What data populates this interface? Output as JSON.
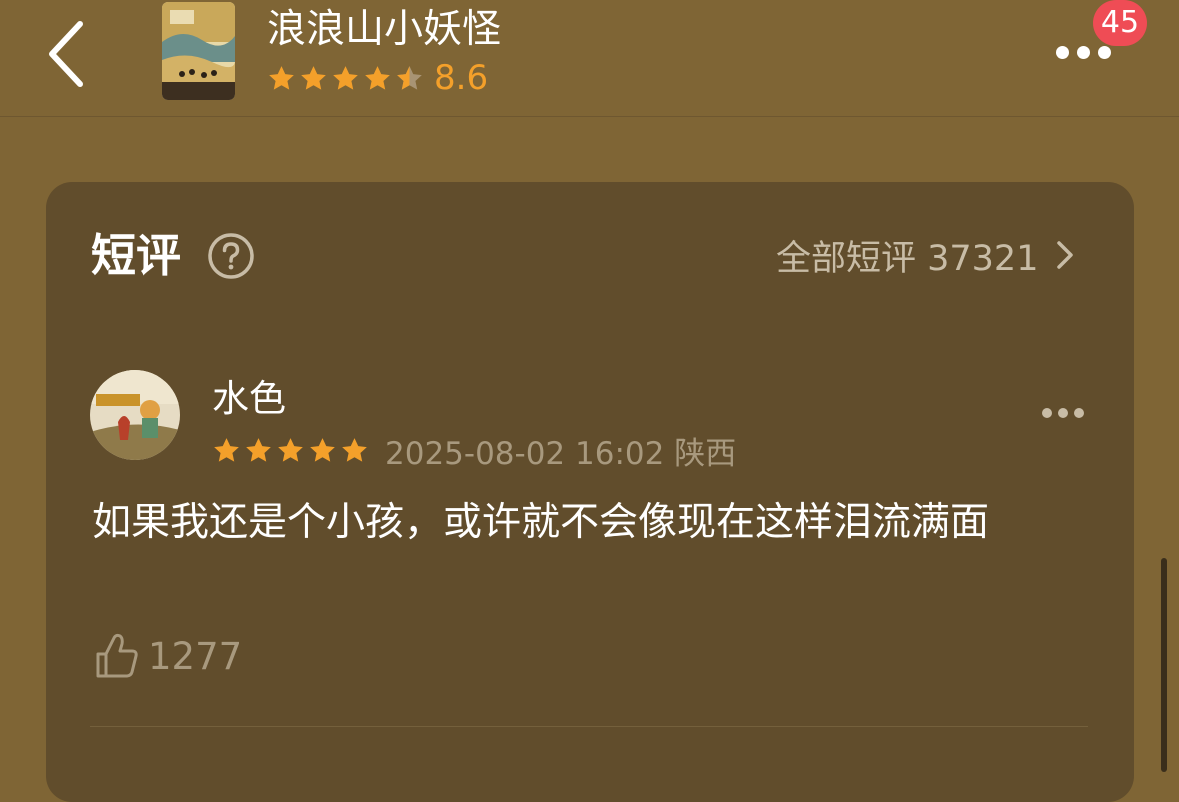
{
  "header": {
    "back_icon": "chevron-left-icon",
    "title": "浪浪山小妖怪",
    "rating": 4.5,
    "score": "8.6",
    "more_icon": "more-dots-icon",
    "badge": "45"
  },
  "section": {
    "title": "短评",
    "help_icon": "question-circle-icon",
    "all_reviews_label": "全部短评 37321",
    "chevron_icon": "chevron-right-icon"
  },
  "comment": {
    "username": "水色",
    "rating": 5,
    "meta": "2025-08-02 16:02 陕西",
    "text": "如果我还是个小孩，或许就不会像现在这样泪流满面",
    "likes": "1277",
    "like_icon": "thumbs-up-icon",
    "more_icon": "more-dots-icon"
  },
  "colors": {
    "background": "#7f6535",
    "card": "#614d2c",
    "star": "#f4a02a",
    "badge": "#ef4c55"
  }
}
